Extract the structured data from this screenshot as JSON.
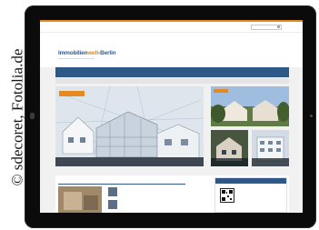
{
  "photo_credit": "© sdecoret, Fotolia.de",
  "website": {
    "logo_part1": "Immobilien",
    "logo_part2": "welt",
    "logo_part3": "-Berlin",
    "colors": {
      "accent": "#e58a1f",
      "nav": "#2d5888",
      "background": "#f1f1f1"
    }
  }
}
